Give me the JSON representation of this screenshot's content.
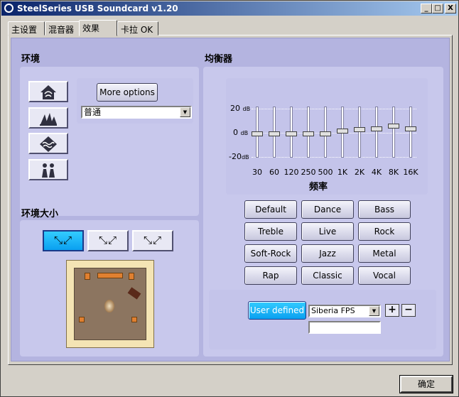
{
  "window": {
    "title": "SteelSeries USB Soundcard v1.20",
    "minimize": "_",
    "restore": "□",
    "close": "X"
  },
  "tabs": [
    {
      "label": "主设置",
      "active": false
    },
    {
      "label": "混音器",
      "active": false
    },
    {
      "label": "效果",
      "active": true
    },
    {
      "label": "卡拉 OK",
      "active": false
    }
  ],
  "environment": {
    "heading": "环境",
    "more_options": "More options",
    "preset_value": "普通",
    "icons": [
      "house-icon",
      "opera-house-icon",
      "waves-icon",
      "people-icon"
    ]
  },
  "environment_size": {
    "heading": "环境大小",
    "options": [
      "small",
      "medium",
      "large"
    ],
    "selected": "small"
  },
  "equalizer": {
    "heading": "均衡器",
    "db_labels": [
      "20",
      "0",
      "-20"
    ],
    "db_unit": "dB",
    "xlabel": "频率",
    "bands": [
      {
        "freq": "30",
        "gain": -1
      },
      {
        "freq": "60",
        "gain": -1
      },
      {
        "freq": "120",
        "gain": -1
      },
      {
        "freq": "250",
        "gain": -1
      },
      {
        "freq": "500",
        "gain": -1
      },
      {
        "freq": "1K",
        "gain": 1
      },
      {
        "freq": "2K",
        "gain": 2
      },
      {
        "freq": "4K",
        "gain": 3
      },
      {
        "freq": "8K",
        "gain": 5
      },
      {
        "freq": "16K",
        "gain": 3
      }
    ],
    "presets": [
      "Default",
      "Dance",
      "Bass",
      "Treble",
      "Live",
      "Rock",
      "Soft-Rock",
      "Jazz",
      "Metal",
      "Rap",
      "Classic",
      "Vocal"
    ],
    "user_defined": "User defined",
    "user_preset": "Siberia FPS",
    "add": "+",
    "remove": "−"
  },
  "footer": {
    "ok": "确定"
  }
}
